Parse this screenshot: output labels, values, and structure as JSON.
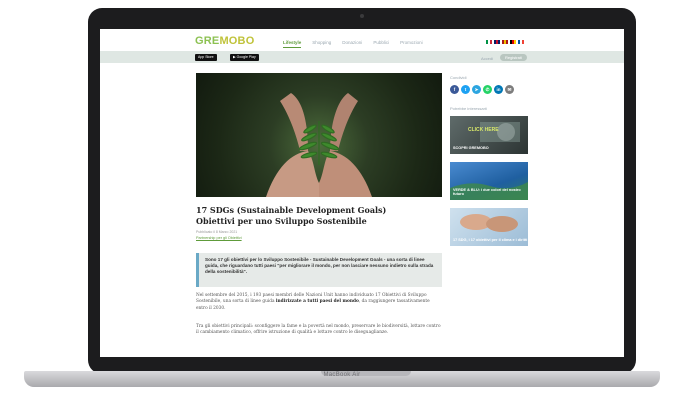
{
  "device": {
    "model_label": "MacBook Air"
  },
  "header": {
    "logo_part1": "GRE",
    "logo_part2": "MOBO",
    "nav": [
      "Lifestyle",
      "Shopping",
      "Donazioni",
      "Pubblici",
      "Promozioni"
    ],
    "flags": [
      {
        "name": "it-flag-icon",
        "colors": [
          "#009246",
          "#ffffff",
          "#ce2b37"
        ]
      },
      {
        "name": "gb-flag-icon",
        "colors": [
          "#012169",
          "#c8102e",
          "#012169"
        ]
      },
      {
        "name": "es-flag-icon",
        "colors": [
          "#aa151b",
          "#f1bf00",
          "#aa151b"
        ]
      },
      {
        "name": "de-flag-icon",
        "colors": [
          "#000000",
          "#dd0000",
          "#ffce00"
        ]
      },
      {
        "name": "fr-flag-icon",
        "colors": [
          "#0055a4",
          "#ffffff",
          "#ef4135"
        ]
      }
    ]
  },
  "subbar": {
    "app_store": "App Store",
    "google_play": "Google Play",
    "login": "Accedi",
    "register": "Registrati"
  },
  "article": {
    "title_line1": "17 SDGs (Sustainable Development Goals)",
    "title_line2": "Obiettivi per uno Sviluppo Sostenibile",
    "date": "Pubblicato il 8 Marzo 2021",
    "byline": "Partnership per gli Obiettivi",
    "quote": "Sono 17 gli obiettivi per lo Sviluppo Sostenibile - Sustainable Development Goals - una sorta di linee guida, che riguardano tutti paesi \"per migliorare il mondo, per non lasciare nessuno indietro sulla strada della sostenibilità\".",
    "p1_text": "Nel settembre del 2015, i 193 paesi membri delle Nazioni Unit hanno individuato 17 Obiettivi di Sviluppo Sostenibile, una sorta di linee guida",
    "p1_bold": "indirizzate a tutti paesi del mondo",
    "p1_end": ", da raggiungere tassativamente entro il 2030.",
    "p2": "Tra gli obiettivi principali: sconfiggere la fame e la povertà nel mondo, preservare le biodiversità, lottare contro il cambiamento climatico, offrire istruzione di qualità e lottare contro le diseguaglianze."
  },
  "sidebar": {
    "share_heading": "Condividi",
    "share_buttons": [
      {
        "name": "facebook-icon",
        "glyph": "f",
        "color": "#3b5998"
      },
      {
        "name": "twitter-icon",
        "glyph": "t",
        "color": "#1da1f2"
      },
      {
        "name": "telegram-icon",
        "glyph": "➤",
        "color": "#2ca5e0"
      },
      {
        "name": "whatsapp-icon",
        "glyph": "✆",
        "color": "#25d366"
      },
      {
        "name": "linkedin-icon",
        "glyph": "in",
        "color": "#0077b5"
      },
      {
        "name": "email-icon",
        "glyph": "✉",
        "color": "#7d7d7d"
      }
    ],
    "related_heading": "Potrebbe interessarti",
    "cards": [
      {
        "badge": "CLICK HERE",
        "caption": "SCOPRI GREMOBO"
      },
      {
        "caption": "VERDE & BLU: i due colori del nostro futuro"
      },
      {
        "caption": "17 SDG, i 17 obiettivi per il clima e i diritti"
      }
    ]
  }
}
